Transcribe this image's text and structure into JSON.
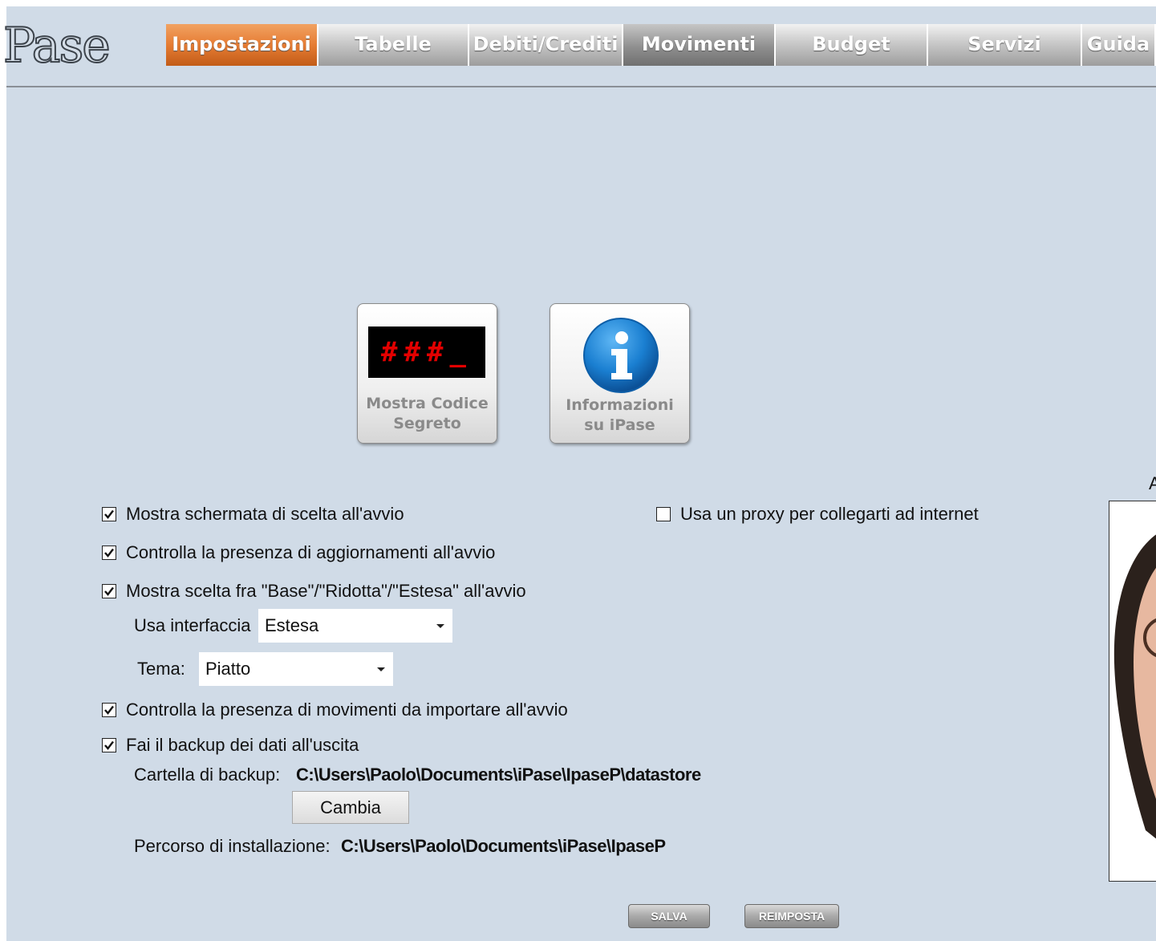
{
  "app": {
    "logo_text": "Pase"
  },
  "tabs": [
    {
      "label": "Impostazioni",
      "active": true
    },
    {
      "label": "Tabelle",
      "active": false
    },
    {
      "label": "Debiti/Crediti",
      "active": false
    },
    {
      "label": "Movimenti",
      "active": false
    },
    {
      "label": "Budget",
      "active": false
    },
    {
      "label": "Servizi",
      "active": false
    },
    {
      "label": "Guida",
      "active": false
    }
  ],
  "big_buttons": {
    "secret_code": {
      "line1": "Mostra Codice",
      "line2": "Segreto",
      "display": "###_"
    },
    "info": {
      "line1": "Informazioni",
      "line2": "su iPase"
    }
  },
  "options": {
    "show_choice_screen": {
      "label": "Mostra schermata di scelta all'avvio",
      "checked": true
    },
    "check_updates": {
      "label": "Controlla la presenza di aggiornamenti all'avvio",
      "checked": true
    },
    "show_interface_choice": {
      "label": "Mostra scelta fra \"Base\"/\"Ridotta\"/\"Estesa\" all'avvio",
      "checked": true
    },
    "check_movements": {
      "label": "Controlla la presenza di movimenti da importare all'avvio",
      "checked": true
    },
    "backup_on_exit": {
      "label": "Fai il backup dei dati all'uscita",
      "checked": true
    },
    "use_proxy": {
      "label": "Usa un proxy per collegarti ad internet",
      "checked": false
    }
  },
  "interface": {
    "label": "Usa interfaccia",
    "value": "Estesa"
  },
  "theme": {
    "label": "Tema:",
    "value": "Piatto"
  },
  "backup": {
    "label": "Cartella di backup:",
    "path": "C:\\Users\\Paolo\\Documents\\iPase\\IpaseP\\datastore",
    "change_label": "Cambia"
  },
  "install": {
    "label": "Percorso di installazione:",
    "path": "C:\\Users\\Paolo\\Documents\\iPase\\IpaseP"
  },
  "footer": {
    "save_label": "SALVA",
    "reset_label": "REIMPOSTA"
  },
  "side_panel": {
    "caption_fragment": "A"
  },
  "colors": {
    "background": "#d0dbe7",
    "active_tab": "#e67c33",
    "info_icon": "#1a7fd1"
  }
}
